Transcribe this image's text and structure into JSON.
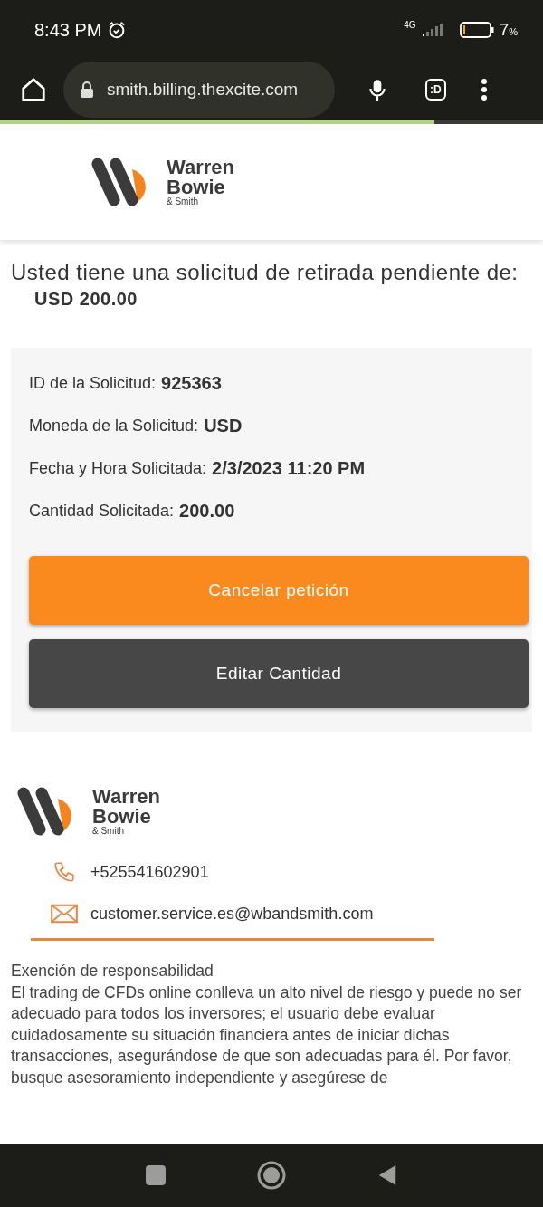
{
  "status_bar": {
    "time": "8:43 PM",
    "network": "4G",
    "battery": "7",
    "battery_unit": "%"
  },
  "browser": {
    "url": "smith.billing.thexcite.com",
    "tab_count": ":D",
    "load_progress": {
      "level": 0.8
    }
  },
  "header": {
    "logo": {
      "line1": "Warren",
      "line2": "Bowie",
      "line3": "& Smith"
    }
  },
  "pending": {
    "text": "Usted tiene una solicitud de retirada pendiente de:",
    "amount": "USD 200.00"
  },
  "details": [
    {
      "label": "ID de la Solicitud:",
      "value": "925363"
    },
    {
      "label": "Moneda de la Solicitud:",
      "value": "USD"
    },
    {
      "label": "Fecha y Hora Solicitada:",
      "value": "2/3/2023 11:20 PM"
    },
    {
      "label": "Cantidad Solicitada:",
      "value": "200.00"
    }
  ],
  "buttons": [
    {
      "label": "Cancelar petición",
      "kind": "primary"
    },
    {
      "label": "Editar Cantidad",
      "kind": "secondary"
    }
  ],
  "footer": {
    "logo": {
      "line1": "Warren",
      "line2": "Bowie",
      "line3": "& Smith"
    },
    "contacts": [
      {
        "kind": "phone",
        "text": "+525541602901"
      },
      {
        "kind": "email",
        "text": "customer.service.es@wbandsmith.com"
      }
    ],
    "disclaimer_title": "Exención de responsabilidad",
    "disclaimer": "El trading de CFDs online conlleva un alto nivel de riesgo y puede no ser adecuado para todos los inversores; el usuario debe evaluar cuidadosamente su situación financiera antes de iniciar dichas transacciones, asegurándose de que son adecuadas para él. Por favor, busque asesoramiento independiente y asegúrese de"
  }
}
